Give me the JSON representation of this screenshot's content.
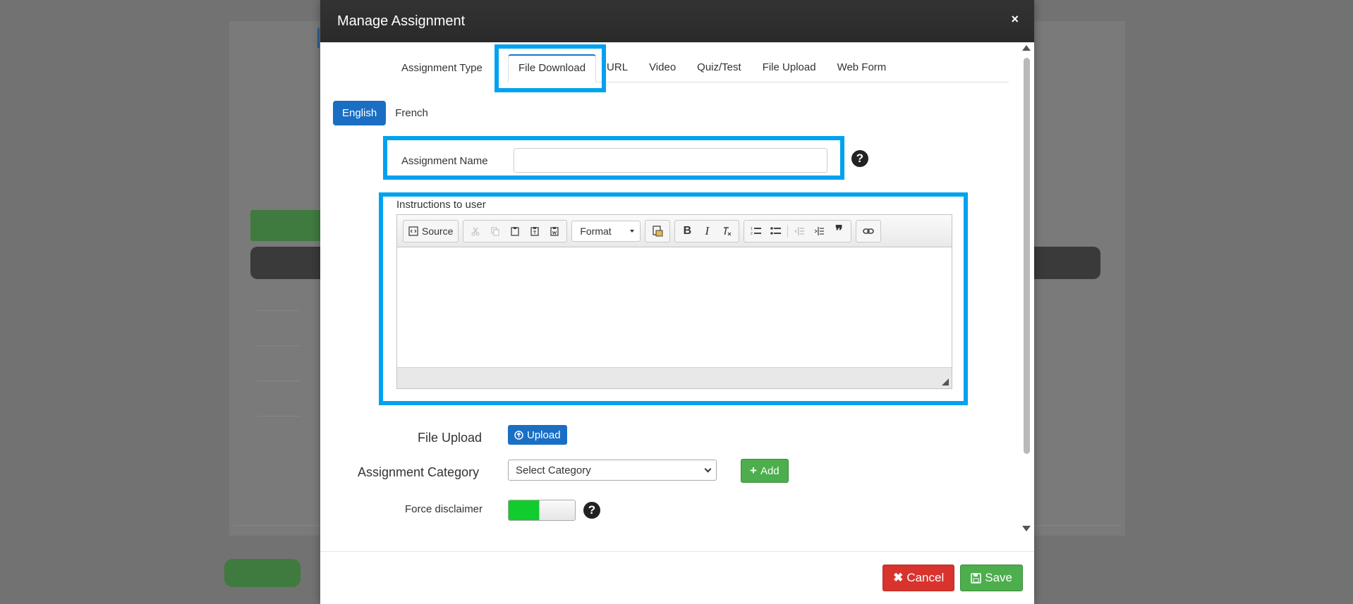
{
  "modal": {
    "title": "Manage Assignment",
    "close_glyph": "×"
  },
  "assignment_type": {
    "label": "Assignment Type",
    "tabs": [
      "File Download",
      "URL",
      "Video",
      "Quiz/Test",
      "File Upload",
      "Web Form"
    ],
    "active_tab": "File Download"
  },
  "languages": {
    "items": [
      "English",
      "French"
    ],
    "active": "English"
  },
  "assignment_name": {
    "label": "Assignment Name",
    "value": "",
    "help_glyph": "?"
  },
  "instructions": {
    "label": "Instructions to user",
    "toolbar": {
      "source_label": "Source",
      "format_label": "Format"
    }
  },
  "file_upload": {
    "label": "File Upload",
    "button_label": "Upload"
  },
  "assignment_category": {
    "label": "Assignment Category",
    "selected": "Select Category",
    "add_label": "Add"
  },
  "force_disclaimer": {
    "label": "Force disclaimer",
    "value": "on",
    "help_glyph": "?"
  },
  "footer": {
    "cancel_label": "Cancel",
    "save_label": "Save"
  },
  "colors": {
    "highlight": "#00a2f0",
    "primary": "#1a6fc4",
    "success": "#4cae4c",
    "danger": "#d9332e",
    "toggle_on": "#10cc2d"
  }
}
